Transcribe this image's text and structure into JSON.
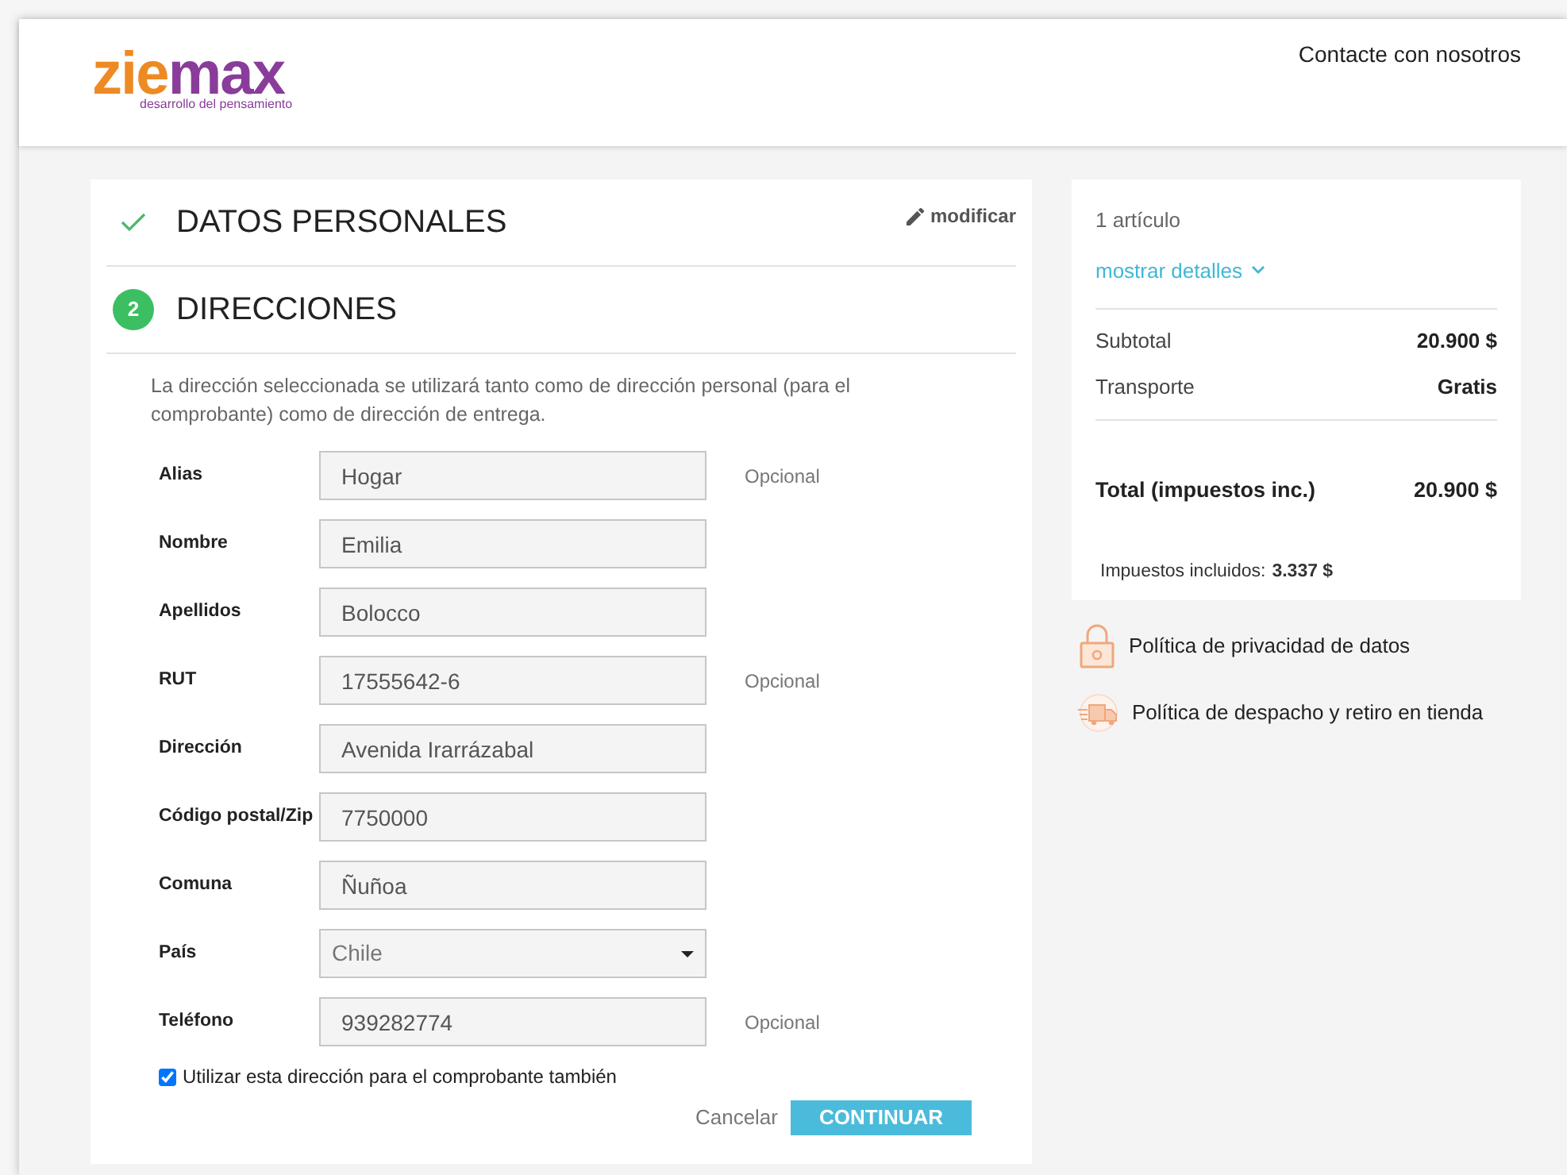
{
  "header": {
    "logo": {
      "brand_start": "zie",
      "brand_end": "max",
      "tagline": "desarrollo del pensamiento"
    },
    "contact_link": "Contacte con nosotros"
  },
  "steps": [
    {
      "kind": "done",
      "title": "DATOS PERSONALES",
      "action": "modificar"
    },
    {
      "kind": "current",
      "number": "2",
      "title": "DIRECCIONES"
    }
  ],
  "address_form": {
    "intro": "La dirección seleccionada se utilizará tanto como de dirección personal (para el comprobante) como de dirección de entrega.",
    "fields": [
      {
        "kind": "text",
        "label": "Alias",
        "value": "Hogar",
        "note": "Opcional"
      },
      {
        "kind": "text",
        "label": "Nombre",
        "value": "Emilia"
      },
      {
        "kind": "text",
        "label": "Apellidos",
        "value": "Bolocco"
      },
      {
        "kind": "text",
        "label": "RUT",
        "value": "17555642-6",
        "note": "Opcional"
      },
      {
        "kind": "text",
        "label": "Dirección",
        "value": "Avenida Irarrázabal"
      },
      {
        "kind": "text",
        "label": "Código postal/Zip",
        "value": "7750000"
      },
      {
        "kind": "text",
        "label": "Comuna",
        "value": "Ñuñoa"
      },
      {
        "kind": "select",
        "label": "País",
        "value": "Chile"
      },
      {
        "kind": "text",
        "label": "Teléfono",
        "value": "939282774",
        "note": "Opcional"
      }
    ],
    "invoice_checkbox": {
      "label": "Utilizar esta dirección para el comprobante también",
      "checked": true
    },
    "cancel": "Cancelar",
    "continue": "CONTINUAR"
  },
  "summary": {
    "items_count": "1 artículo",
    "details_link": "mostrar detalles",
    "lines": [
      {
        "label": "Subtotal",
        "value": "20.900 $"
      },
      {
        "label": "Transporte",
        "value": "Gratis"
      }
    ],
    "total_label": "Total (impuestos inc.)",
    "total_value": "20.900 $",
    "taxes_label": "Impuestos incluidos:",
    "taxes_value": "3.337 $"
  },
  "policies": [
    {
      "kind": "lock",
      "label": "Política de privacidad de datos"
    },
    {
      "kind": "truck",
      "label": "Política de despacho y retiro en tienda"
    }
  ]
}
